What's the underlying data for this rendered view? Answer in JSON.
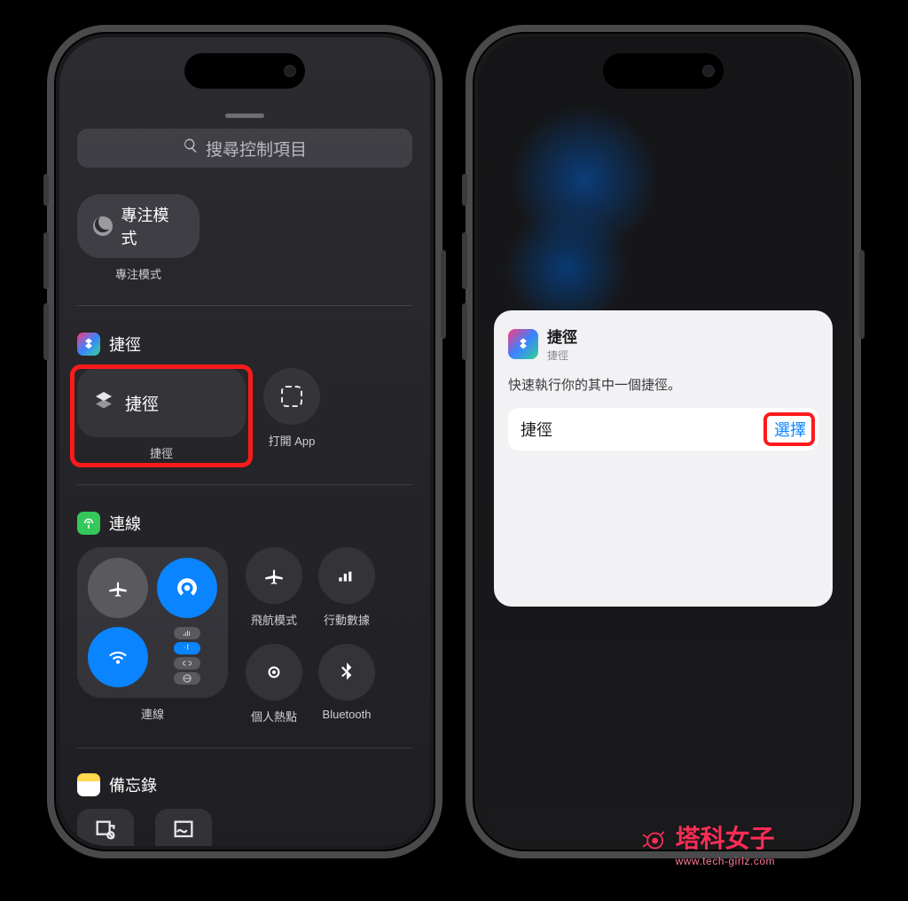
{
  "left": {
    "search_placeholder": "搜尋控制項目",
    "focus": {
      "pill": "專注模式",
      "caption": "專注模式"
    },
    "shortcuts": {
      "section_title": "捷徑",
      "tile_label": "捷徑",
      "tile_caption": "捷徑",
      "open_app_caption": "打開 App"
    },
    "connectivity": {
      "section_title": "連線",
      "box_caption": "連線",
      "singles": {
        "airplane": "飛航模式",
        "cellular": "行動數據",
        "hotspot": "個人熱點",
        "bluetooth": "Bluetooth"
      }
    },
    "notes": {
      "section_title": "備忘錄"
    }
  },
  "right": {
    "card": {
      "title": "捷徑",
      "subtitle": "捷徑",
      "description": "快速執行你的其中一個捷徑。",
      "row_label": "捷徑",
      "select": "選擇"
    }
  },
  "watermark": {
    "name": "塔科女子",
    "url": "www.tech-girlz.com"
  }
}
